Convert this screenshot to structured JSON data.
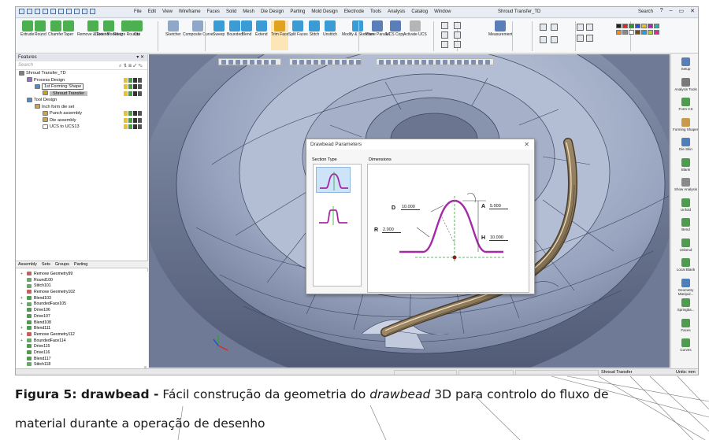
{
  "app": {
    "menu": [
      "File",
      "Edit",
      "View",
      "Wireframe",
      "Faces",
      "Solid",
      "Mesh",
      "Die Design",
      "Parting",
      "Mold Design",
      "Electrode",
      "Tools",
      "Analysis",
      "Catalog",
      "Window"
    ],
    "document_title": "Shroud Transfer_TD",
    "search_label": "Search",
    "window_controls": [
      "?",
      "–",
      "▭",
      "✕"
    ]
  },
  "ribbon": {
    "buttons": [
      {
        "label": "Extrude",
        "icon": "extrude-icon"
      },
      {
        "label": "Round",
        "icon": "round-icon"
      },
      {
        "label": "Chamfer",
        "icon": "chamfer-icon"
      },
      {
        "label": "Taper",
        "icon": "taper-icon"
      },
      {
        "label": "Remove & Extend",
        "icon": "remove-extend-icon"
      },
      {
        "label": "Direct Modeling",
        "icon": "direct-modeling-icon"
      },
      {
        "label": "Resize Rounds",
        "icon": "resize-rounds-icon"
      },
      {
        "label": "Cut",
        "icon": "cut-icon"
      },
      {
        "label": "Sketcher",
        "icon": "sketcher-icon"
      },
      {
        "label": "Composite Curve",
        "icon": "composite-curve-icon"
      },
      {
        "label": "Sweep",
        "icon": "sweep-icon"
      },
      {
        "label": "Bounded",
        "icon": "bounded-icon"
      },
      {
        "label": "Blend",
        "icon": "blend-icon"
      },
      {
        "label": "Extend",
        "icon": "extend-icon"
      },
      {
        "label": "Trim Face",
        "icon": "trim-face-icon"
      },
      {
        "label": "Split Faces",
        "icon": "split-faces-icon"
      },
      {
        "label": "Stitch",
        "icon": "stitch-icon"
      },
      {
        "label": "Unstitch",
        "icon": "unstitch-icon"
      },
      {
        "label": "Modify & Sketcher",
        "icon": "modify-sketcher-icon"
      },
      {
        "label": "Plane Parallel",
        "icon": "plane-parallel-icon"
      },
      {
        "label": "UCS Copy",
        "icon": "ucs-copy-icon"
      },
      {
        "label": "Activate UCS",
        "icon": "activate-ucs-icon"
      },
      {
        "label": "Measurement",
        "icon": "measurement-icon"
      }
    ],
    "palette_colors": [
      "#1f1f1f",
      "#d42a2a",
      "#2a9a2a",
      "#2a4fd4",
      "#e3c12a",
      "#b02ab0",
      "#2ab0b0",
      "#f58a1f",
      "#8a8a8a",
      "#ffffff",
      "#7a4a1f",
      "#1fa0e3",
      "#a3d42a",
      "#e32a8a"
    ]
  },
  "features_panel": {
    "title": "Features",
    "search_placeholder": "Search",
    "tree": [
      {
        "label": "Shroud Transfer_TD",
        "indent": 0,
        "color": "#7f7f7f"
      },
      {
        "label": "Process Design",
        "indent": 1,
        "color": "#9c6bd1"
      },
      {
        "label": "1st Forming Shape",
        "indent": 2,
        "color": "#4b8ed1",
        "boxed": true
      },
      {
        "label": "Shroud Transfer",
        "indent": 3,
        "color": "#c9a227",
        "selected": true
      },
      {
        "label": "Tool Design",
        "indent": 1,
        "color": "#4b8ed1"
      },
      {
        "label": "Inch form die set",
        "indent": 2,
        "color": "#d1a34b"
      },
      {
        "label": "Punch assembly",
        "indent": 3,
        "color": "#d1a34b"
      },
      {
        "label": "Die assembly",
        "indent": 3,
        "color": "#d1a34b"
      },
      {
        "label": "UCS to UCS13",
        "indent": 3,
        "color": "#ffffff"
      }
    ],
    "tabs": [
      "Assembly",
      "Sets",
      "Groups",
      "Parting"
    ],
    "history": [
      "Remove Geometry99",
      "Round100",
      "Stitch101",
      "Remove Geometry102",
      "Blend103",
      "BoundedFace105",
      "Drive106",
      "Drive107",
      "Blend108",
      "Blend111",
      "Remove Geometry112",
      "BoundedFace114",
      "Drive115",
      "Drive116",
      "Blend117",
      "Stitch118",
      "Composite119",
      "Move Linear120",
      "Composite121"
    ],
    "bottom_tabs": [
      "Features",
      "Sets",
      "M-View"
    ]
  },
  "dialog": {
    "title": "Drawbead Parameters",
    "close": "✕",
    "section_type_label": "Section Type",
    "dimensions_label": "Dimensions",
    "dims": [
      {
        "name": "D",
        "value": "10.000"
      },
      {
        "name": "A",
        "value": "5.000"
      },
      {
        "name": "R",
        "value": "2.000"
      },
      {
        "name": "H",
        "value": "10.000"
      }
    ]
  },
  "right_panel": {
    "items": [
      {
        "label": "Setup",
        "color": "#5a7fb8"
      },
      {
        "label": "Analysis Tools",
        "color": "#7a7a7a"
      },
      {
        "label": "Form CS",
        "color": "#4f9b4f"
      },
      {
        "label": "Forming Shapes",
        "color": "#c99a4b"
      },
      {
        "label": "Die Skin",
        "color": "#4f7fb8"
      },
      {
        "label": "Blank",
        "color": "#4f9b4f"
      },
      {
        "label": "Show Analysis",
        "color": "#8a8a8a"
      },
      {
        "label": "Unfold",
        "color": "#4f9b4f"
      },
      {
        "label": "Bend",
        "color": "#4f9b4f"
      },
      {
        "label": "Unbend",
        "color": "#4f9b4f"
      },
      {
        "label": "Local Blank",
        "color": "#4f9b4f"
      },
      {
        "label": "Geometry Manipul...",
        "color": "#4f7fb8"
      },
      {
        "label": "Springba...",
        "color": "#4f9b4f"
      },
      {
        "label": "Faces",
        "color": "#4f9b4f"
      },
      {
        "label": "Curves",
        "color": "#4f9b4f"
      }
    ]
  },
  "status": {
    "document": "Shroud Transfer",
    "units": "Units: mm"
  },
  "caption": {
    "label": "Figura 5: drawbead -",
    "text_1": " Fácil construção da geometria do ",
    "italic": "drawbead",
    "text_2": " 3D para controlo do fluxo de material durante a operação de desenho"
  }
}
